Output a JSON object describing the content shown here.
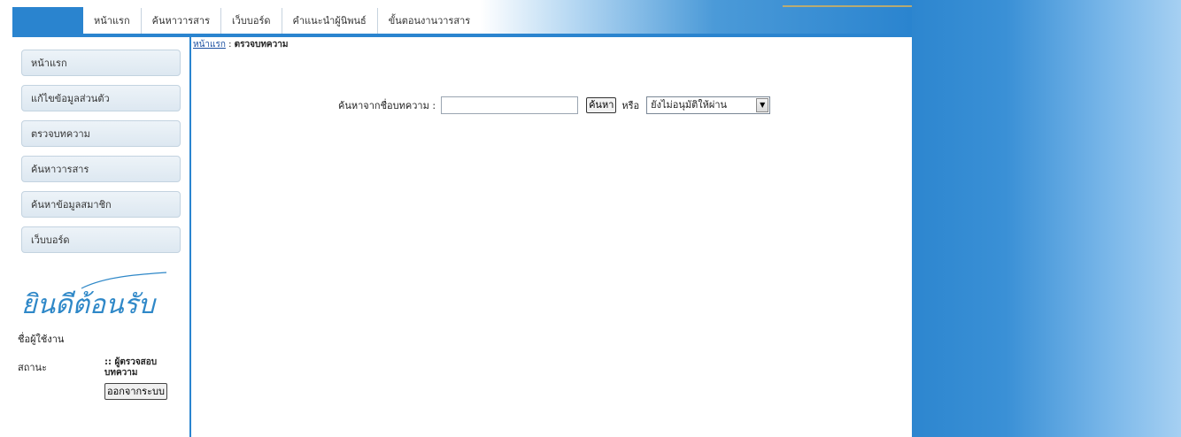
{
  "nav": {
    "items": [
      {
        "label": "หน้าแรก"
      },
      {
        "label": "ค้นหาวารสาร"
      },
      {
        "label": "เว็บบอร์ด"
      },
      {
        "label": "คำแนะนำผู้นิพนธ์"
      },
      {
        "label": "ขั้นตอนงานวารสาร"
      }
    ]
  },
  "sidebar": {
    "items": [
      {
        "label": "หน้าแรก"
      },
      {
        "label": "แก้ไขข้อมูลส่วนตัว"
      },
      {
        "label": "ตรวจบทความ"
      },
      {
        "label": "ค้นหาวารสาร"
      },
      {
        "label": "ค้นหาข้อมูลสมาชิก"
      },
      {
        "label": "เว็บบอร์ด"
      }
    ],
    "welcome_text": "ยินดีต้อนรับ",
    "user_label": "ชื่อผู้ใช้งาน",
    "status_label": "สถานะ",
    "status_value": ":: ผู้ตรวจสอบบทความ",
    "logout_label": "ออกจากระบบ"
  },
  "breadcrumb": {
    "home": "หน้าแรก",
    "separator": " : ",
    "current": "ตรวจบทความ"
  },
  "search": {
    "label": "ค้นหาจากชื่อบทความ :",
    "value": "",
    "button_label": "ค้นหา",
    "or_label": "หรือ",
    "select_value": "ยังไม่อนุมัติให้ผ่าน"
  },
  "colors": {
    "accent": "#2a84cf",
    "welcome": "#2f88c8"
  }
}
